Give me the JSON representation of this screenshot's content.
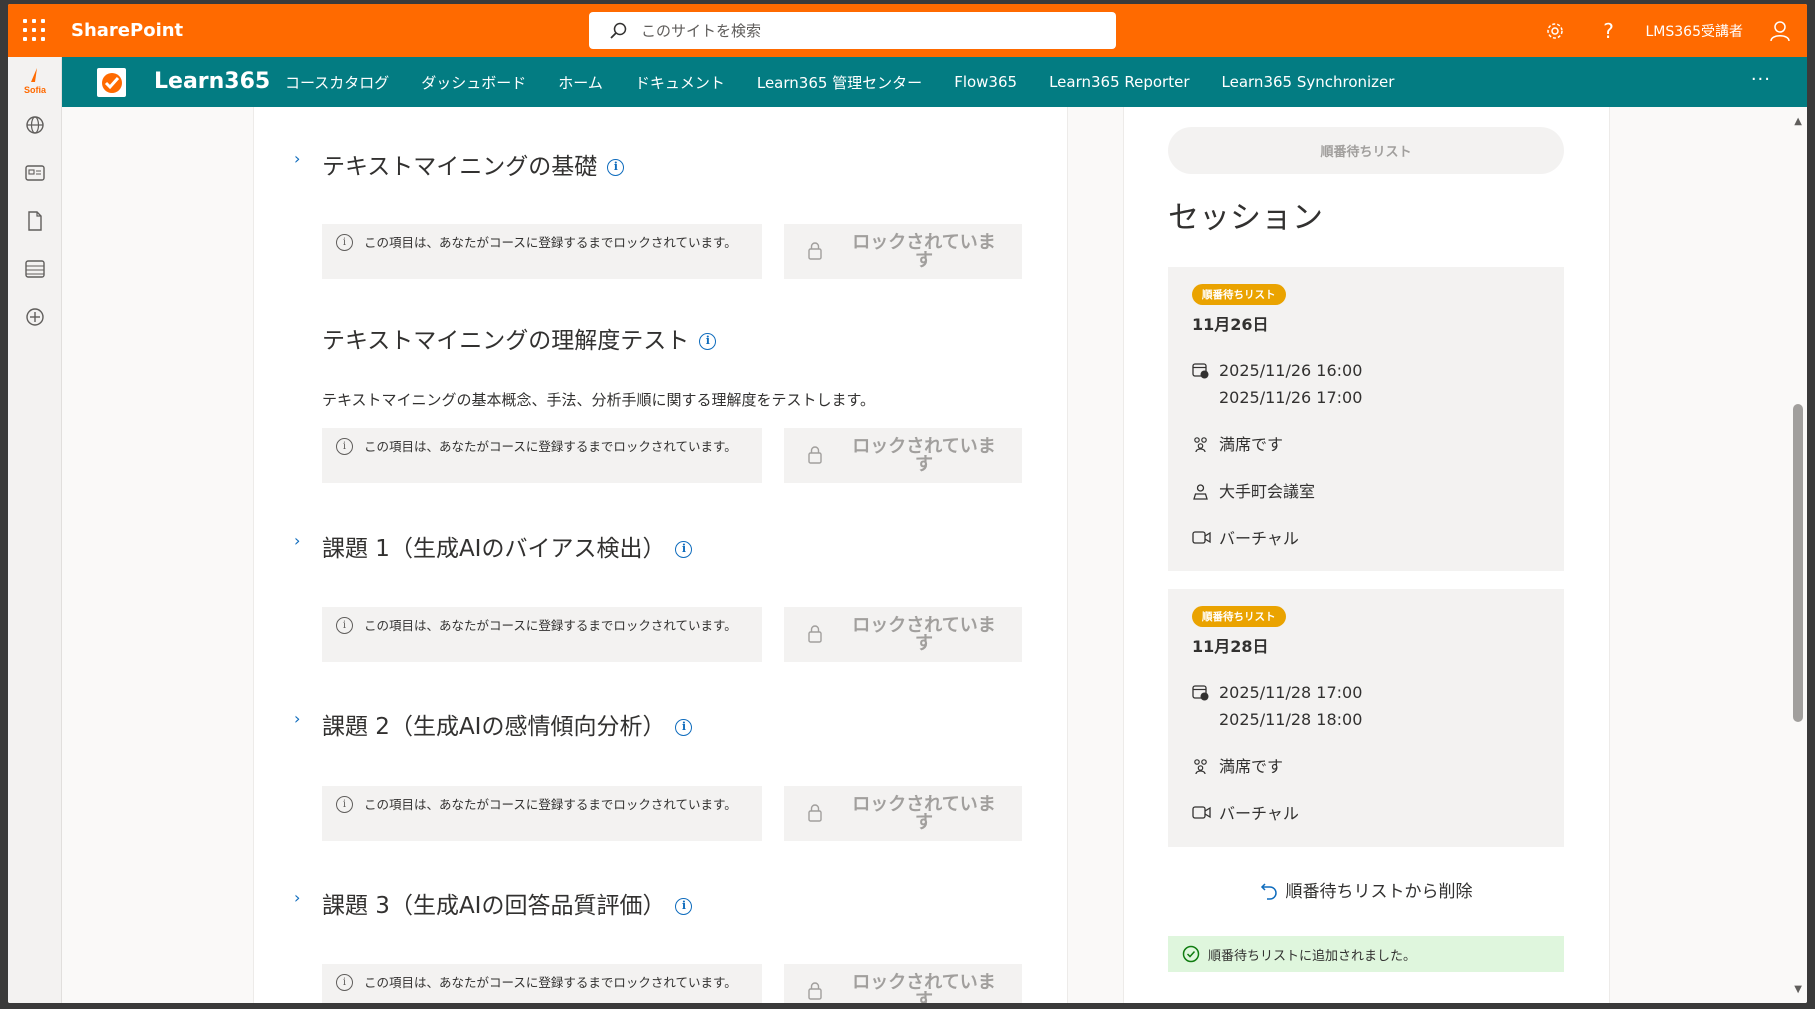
{
  "suite": {
    "brand": "SharePoint",
    "search_placeholder": "このサイトを検索",
    "user_name": "LMS365受講者",
    "help_glyph": "?"
  },
  "rail": {
    "logo_label": "Sofia"
  },
  "site": {
    "title": "Learn365",
    "nav": [
      "コースカタログ",
      "ダッシュボード",
      "ホーム",
      "ドキュメント",
      "Learn365 管理センター",
      "Flow365",
      "Learn365 Reporter",
      "Learn365 Synchronizer"
    ],
    "more": "···"
  },
  "common": {
    "lock_message": "この項目は、あなたがコースに登録するまでロックされています。",
    "lock_button": "ロックされています",
    "info_glyph": "i"
  },
  "items": [
    {
      "title": "テキストマイニングの基礎",
      "expandable": true,
      "description": ""
    },
    {
      "title": "テキストマイニングの理解度テスト",
      "expandable": false,
      "description": "テキストマイニングの基本概念、手法、分析手順に関する理解度をテストします。"
    },
    {
      "title": "課題 1（生成AIのバイアス検出）",
      "expandable": true,
      "description": ""
    },
    {
      "title": "課題 2（生成AIの感情傾向分析）",
      "expandable": true,
      "description": ""
    },
    {
      "title": "課題 3（生成AIの回答品質評価）",
      "expandable": true,
      "description": ""
    }
  ],
  "right": {
    "waitlist_button": "順番待ちリスト",
    "heading": "セッション",
    "sessions": [
      {
        "badge": "順番待ちリスト",
        "date": "11月26日",
        "start": "2025/11/26 16:00",
        "end": "2025/11/26 17:00",
        "capacity": "満席です",
        "location": "大手町会議室",
        "format": "バーチャル"
      },
      {
        "badge": "順番待ちリスト",
        "date": "11月28日",
        "start": "2025/11/28 17:00",
        "end": "2025/11/28 18:00",
        "capacity": "満席です",
        "format": "バーチャル"
      }
    ],
    "remove_link": "順番待ちリストから削除",
    "success_message": "順番待ちリストに追加されました。"
  },
  "colors": {
    "suite_bar": "#ff6a00",
    "nav_bar": "#037c82",
    "badge": "#eaa300",
    "success_bg": "#dff6dd",
    "link": "#0f6cbd"
  }
}
